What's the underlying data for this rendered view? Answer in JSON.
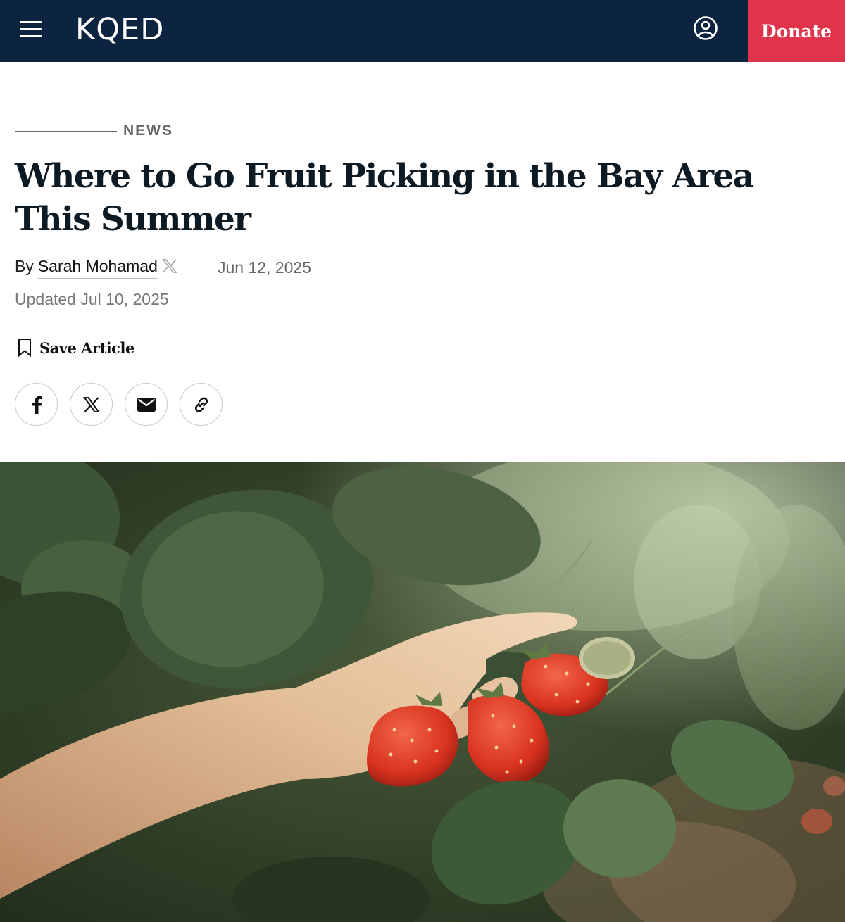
{
  "header": {
    "logo_text": "KQED",
    "donate_label": "Donate",
    "background_color": "#0d2440",
    "donate_color": "#e0344d",
    "icons": [
      "hamburger-menu-icon",
      "user-account-icon"
    ]
  },
  "article": {
    "category": "NEWS",
    "headline": "Where to Go Fruit Picking in the Bay Area This Summer",
    "byline_prefix": "By",
    "author": "Sarah Mohamad",
    "published_date": "Jun 12, 2025",
    "updated": "Updated Jul 10, 2025",
    "save_label": "Save Article"
  },
  "share": {
    "icons": [
      "facebook-icon",
      "x-icon",
      "email-icon",
      "link-icon"
    ]
  },
  "hero_image": {
    "subject": "hand-picking-strawberries-photo"
  }
}
